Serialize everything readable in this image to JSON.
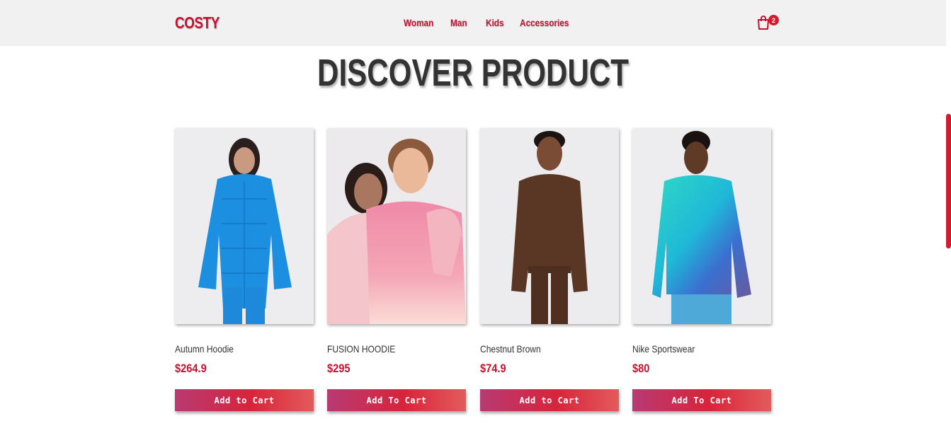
{
  "header": {
    "logo": "COSTY",
    "nav": [
      "Woman",
      "Man",
      "Kids",
      "Accessories"
    ],
    "cart_icon": "shopping-bag-icon",
    "cart_count": "2"
  },
  "main": {
    "title": "DISCOVER PRODUCT",
    "products": [
      {
        "name": "Autumn Hoodie",
        "price": "$264.9",
        "button": "Add to Cart",
        "image": "model in blue puffer jacket"
      },
      {
        "name": "FUSION HOODIE",
        "price": "$295",
        "button": "Add To Cart",
        "image": "two models in pink hoodies"
      },
      {
        "name": "Chestnut Brown",
        "price": "$74.9",
        "button": "Add to Cart",
        "image": "model in brown hoodie"
      },
      {
        "name": "Nike Sportswear",
        "price": "$80",
        "button": "Add To Cart",
        "image": "model in teal and purple sweatshirt"
      }
    ]
  },
  "colors": {
    "brand": "#c8102e",
    "header_bg": "#f2f1f2",
    "title": "#333333"
  }
}
